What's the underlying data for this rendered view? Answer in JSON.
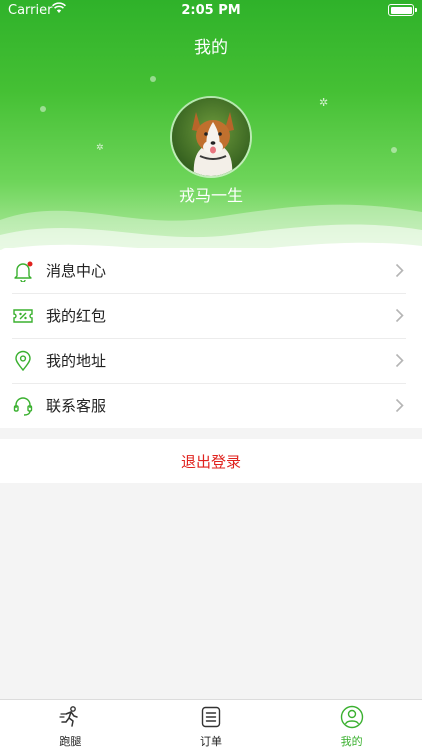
{
  "status_bar": {
    "carrier": "Carrier",
    "time": "2:05 PM"
  },
  "header": {
    "title": "我的",
    "username": "戎马一生"
  },
  "menu": {
    "items": [
      {
        "label": "消息中心",
        "icon": "bell-icon"
      },
      {
        "label": "我的红包",
        "icon": "coupon-icon"
      },
      {
        "label": "我的地址",
        "icon": "location-pin-icon"
      },
      {
        "label": "联系客服",
        "icon": "headset-icon"
      }
    ]
  },
  "logout": {
    "label": "退出登录"
  },
  "tabbar": {
    "tabs": [
      {
        "label": "跑腿",
        "icon": "runner-icon",
        "active": false
      },
      {
        "label": "订单",
        "icon": "order-list-icon",
        "active": false
      },
      {
        "label": "我的",
        "icon": "profile-icon",
        "active": true
      }
    ]
  },
  "colors": {
    "primary": "#3ab02f",
    "danger": "#e0221e",
    "background": "#f4f4f4"
  }
}
